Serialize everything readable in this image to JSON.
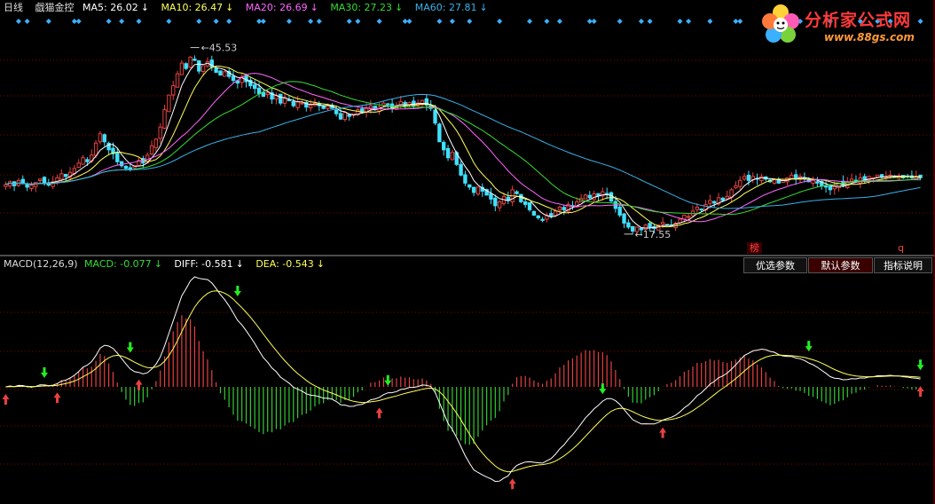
{
  "colors": {
    "background": "#000000",
    "grid": "#8b0000",
    "up": "#e84040",
    "down": "#40e0ff",
    "ma5": "#ffffff",
    "ma10": "#ffff55",
    "ma20": "#ff66ff",
    "ma30": "#33dd33",
    "ma60": "#3ab0e8",
    "diff": "#ffffff",
    "dea": "#ffff55",
    "macd_pos": "#e84040",
    "macd_neg": "#33cc33",
    "diamond": "#3ab0ff"
  },
  "header": {
    "period": "日线",
    "indicator": "戯猫金控",
    "ma5": "MA5: 26.02",
    "ma10": "MA10: 26.47",
    "ma20": "MA20: 26.69",
    "ma30": "MA30: 27.23",
    "ma60": "MA60: 27.81",
    "arrow": "↓"
  },
  "macd_header": {
    "name": "MACD(12,26,9)",
    "macd": "MACD: -0.077",
    "diff": "DIFF: -0.581",
    "dea": "DEA: -0.543",
    "arrow": "↓"
  },
  "buttons": {
    "optimize": "优选参数",
    "default": "默认参数",
    "help": "指标说明"
  },
  "tags": {
    "rank": "榜",
    "q": "q"
  },
  "logo": {
    "title": "分析家公式网",
    "url": "www.88gs.com"
  },
  "chart_data": [
    {
      "type": "candlestick",
      "title": "",
      "annotations": [
        {
          "label": "45.53",
          "value": 45.53,
          "bar": 43
        },
        {
          "label": "17.55",
          "value": 17.55,
          "bar": 144
        }
      ],
      "ylim": [
        15,
        50
      ],
      "bars": 214,
      "closes": [
        25.0,
        25.4,
        24.8,
        25.6,
        25.1,
        24.6,
        24.9,
        25.3,
        25.8,
        25.2,
        24.9,
        25.4,
        26.0,
        26.6,
        26.2,
        26.8,
        27.4,
        28.2,
        29.0,
        28.4,
        29.4,
        31.2,
        32.6,
        31.4,
        30.2,
        29.6,
        28.4,
        27.8,
        27.4,
        27.2,
        27.8,
        28.6,
        28.2,
        29.4,
        30.8,
        31.8,
        33.6,
        36.2,
        38.4,
        39.8,
        41.6,
        43.2,
        42.4,
        44.1,
        43.6,
        42.0,
        42.8,
        43.4,
        42.6,
        41.8,
        41.4,
        41.9,
        41.2,
        40.6,
        40.2,
        41.1,
        40.4,
        39.8,
        39.4,
        38.6,
        38.2,
        38.8,
        37.8,
        38.4,
        37.2,
        37.9,
        37.6,
        36.8,
        37.4,
        37.2,
        36.6,
        36.9,
        37.2,
        36.8,
        36.4,
        36.9,
        36.4,
        35.6,
        34.8,
        35.8,
        35.2,
        35.6,
        36.2,
        35.8,
        36.4,
        36.8,
        36.2,
        36.6,
        37.2,
        37.0,
        36.4,
        36.8,
        37.4,
        36.9,
        37.3,
        36.8,
        37.2,
        37.6,
        36.9,
        36.4,
        34.2,
        31.4,
        30.2,
        29.0,
        29.8,
        28.0,
        26.4,
        25.2,
        24.6,
        23.8,
        24.6,
        24.0,
        23.4,
        22.8,
        21.8,
        22.4,
        23.2,
        22.6,
        24.2,
        23.6,
        22.4,
        22.0,
        21.2,
        20.4,
        20.0,
        19.6,
        20.4,
        20.2,
        21.0,
        21.6,
        21.2,
        22.0,
        21.8,
        22.4,
        22.9,
        23.4,
        23.0,
        23.6,
        23.3,
        23.9,
        23.5,
        22.5,
        21.4,
        20.4,
        19.2,
        18.6,
        18.0,
        18.6,
        18.2,
        18.9,
        18.6,
        18.4,
        18.9,
        19.3,
        19.0,
        18.8,
        19.2,
        19.8,
        20.4,
        20.2,
        21.0,
        21.6,
        21.2,
        22.0,
        22.6,
        22.2,
        23.0,
        22.6,
        23.2,
        24.2,
        24.8,
        25.6,
        26.2,
        25.6,
        26.2,
        25.8,
        26.2,
        25.8,
        25.4,
        25.8,
        25.2,
        25.6,
        26.0,
        26.4,
        25.8,
        26.2,
        25.8,
        25.4,
        25.6,
        25.2,
        24.8,
        24.6,
        24.2,
        24.8,
        25.2,
        24.8,
        25.4,
        25.8,
        25.4,
        26.0,
        25.6,
        26.2,
        26.0,
        26.4,
        26.1,
        26.2,
        26.4,
        26.1,
        26.3,
        26.0,
        26.2,
        26.0,
        26.2,
        26.0
      ]
    },
    {
      "type": "bar",
      "title": "MACD(12,26,9)",
      "series": [
        {
          "name": "MACD"
        },
        {
          "name": "DIFF"
        },
        {
          "name": "DEA"
        }
      ],
      "signals": {
        "up_arrows": [
          0,
          12,
          31,
          87,
          118,
          153,
          213
        ],
        "down_arrows": [
          9,
          29,
          54,
          89,
          139,
          187,
          213
        ]
      }
    }
  ]
}
